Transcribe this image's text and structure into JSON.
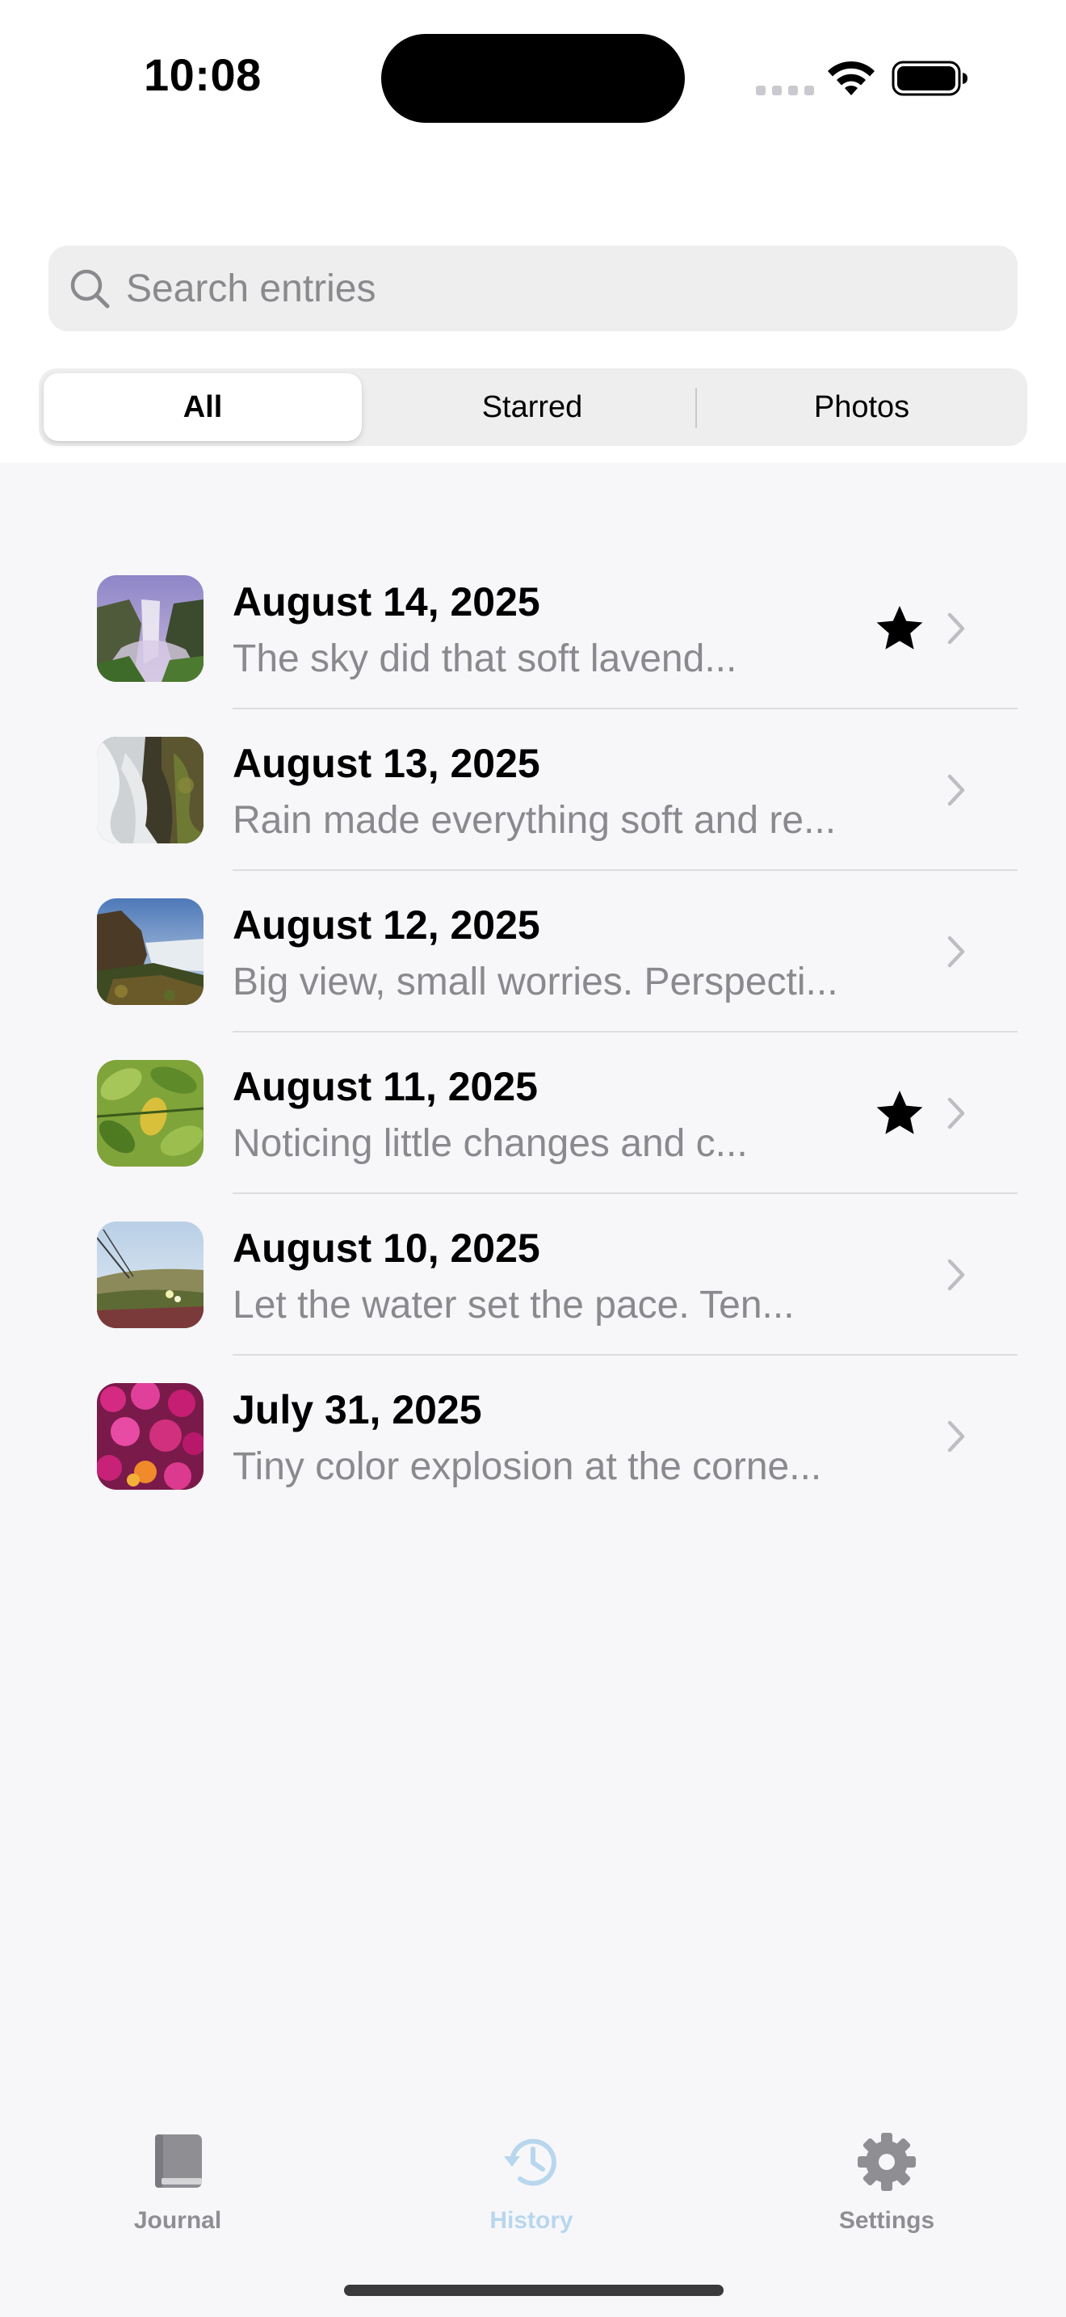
{
  "status_bar": {
    "time": "10:08"
  },
  "search": {
    "placeholder": "Search entries",
    "value": ""
  },
  "filter": {
    "options": [
      "All",
      "Starred",
      "Photos"
    ],
    "selected": "All"
  },
  "entries": [
    {
      "date": "August 14, 2025",
      "preview": "The sky did that soft lavend...",
      "starred": true,
      "thumbnail": "waterfall-mist-photo"
    },
    {
      "date": "August 13, 2025",
      "preview": "Rain made everything soft and re...",
      "starred": false,
      "thumbnail": "waterfall-closeup-photo"
    },
    {
      "date": "August 12, 2025",
      "preview": "Big view, small worries. Perspecti...",
      "starred": false,
      "thumbnail": "cliff-coast-photo"
    },
    {
      "date": "August 11, 2025",
      "preview": "Noticing little changes and c...",
      "starred": true,
      "thumbnail": "green-leaves-photo"
    },
    {
      "date": "August 10, 2025",
      "preview": "Let the water set the pace. Ten...",
      "starred": false,
      "thumbnail": "hillside-flowers-photo"
    },
    {
      "date": "July 31, 2025",
      "preview": "Tiny color explosion at the corne...",
      "starred": false,
      "thumbnail": "pink-flowers-photo"
    }
  ],
  "tab_bar": {
    "tabs": [
      {
        "label": "Journal",
        "icon": "book-icon"
      },
      {
        "label": "History",
        "icon": "history-clock-icon"
      },
      {
        "label": "Settings",
        "icon": "gear-icon"
      }
    ],
    "active": "History"
  },
  "colors": {
    "background": "#F7F7FA",
    "accent_inactive": "#B8D7EE",
    "secondary_text": "#8A8A8E"
  }
}
